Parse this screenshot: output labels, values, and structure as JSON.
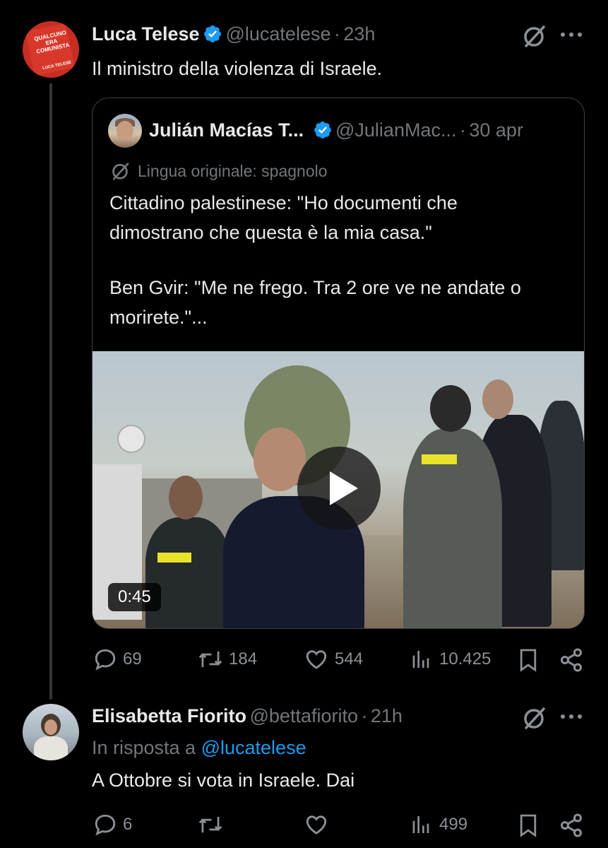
{
  "tweet1": {
    "name": "Luca Telese",
    "handle": "@lucatelese",
    "separator": "·",
    "time": "23h",
    "text": "Il ministro della violenza di Israele.",
    "avatar_text_top": "QUALCUNO ERA COMUNISTA",
    "avatar_text_bottom": "LUCA TELESE"
  },
  "quote": {
    "name": "Julián Macías T...",
    "handle": "@JulianMac...",
    "separator": "·",
    "time": "30 apr",
    "translate_note": "Lingua originale: spagnolo",
    "text_line1": "Cittadino palestinese:  \"Ho documenti che",
    "text_line2": "dimostrano che questa è la mia casa.\"",
    "text_line3": "Ben Gvir: \"Me ne frego. Tra 2 ore ve ne andate o",
    "text_line4": "morirete.\"...",
    "video_duration": "0:45"
  },
  "tweet1_actions": {
    "replies": "69",
    "retweets": "184",
    "likes": "544",
    "views": "10.425"
  },
  "tweet2": {
    "name": "Elisabetta Fiorito",
    "handle": "@bettafiorito",
    "separator": "·",
    "time": "21h",
    "reply_prefix": "In risposta a",
    "reply_handle": "@lucatelese",
    "text": "A Ottobre si vota in Israele. Dai"
  },
  "tweet2_actions": {
    "replies": "6",
    "views": "499"
  },
  "colors": {
    "background": "#000000",
    "text": "#e7e9ea",
    "muted": "#71767b",
    "link": "#1d9bf0",
    "border": "#3e4144"
  }
}
